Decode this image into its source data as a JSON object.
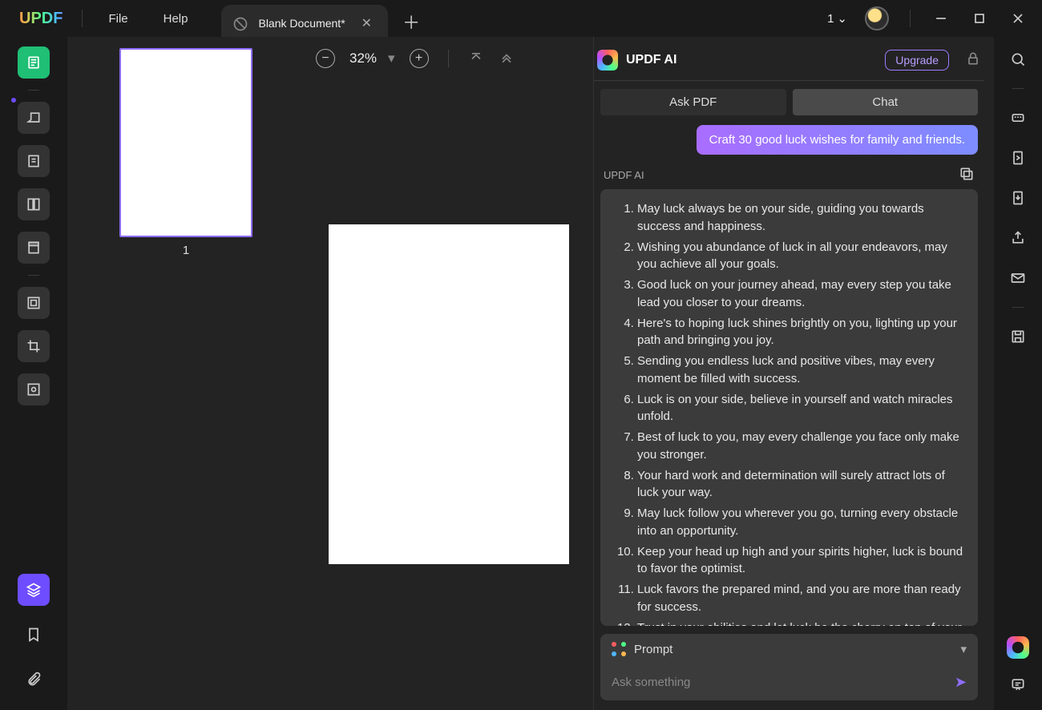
{
  "titlebar": {
    "logo": "UPDF",
    "menu": {
      "file": "File",
      "help": "Help"
    },
    "tab": {
      "title": "Blank Document*"
    },
    "doc_count": "1"
  },
  "zoom": {
    "value": "32%"
  },
  "thumbnail": {
    "page_number": "1"
  },
  "ai": {
    "title": "UPDF AI",
    "upgrade": "Upgrade",
    "tabs": {
      "ask_pdf": "Ask PDF",
      "chat": "Chat"
    },
    "user_message": "Craft 30 good luck wishes for family and friends.",
    "response_label": "UPDF AI",
    "response_items": [
      "May luck always be on your side, guiding you towards success and happiness.",
      "Wishing you abundance of luck in all your endeavors, may you achieve all your goals.",
      "Good luck on your journey ahead, may every step you take lead you closer to your dreams.",
      "Here's to hoping luck shines brightly on you, lighting up your path and bringing you joy.",
      "Sending you endless luck and positive vibes, may every moment be filled with success.",
      "Luck is on your side, believe in yourself and watch miracles unfold.",
      "Best of luck to you, may every challenge you face only make you stronger.",
      "Your hard work and determination will surely attract lots of luck your way.",
      "May luck follow you wherever you go, turning every obstacle into an opportunity.",
      "Keep your head up high and your spirits higher, luck is bound to favor the optimist.",
      "Luck favors the prepared mind, and you are more than ready for success.",
      "Trust in your abilities and let luck be the cherry on top of your efforts."
    ],
    "prompt_label": "Prompt",
    "ask_placeholder": "Ask something"
  }
}
